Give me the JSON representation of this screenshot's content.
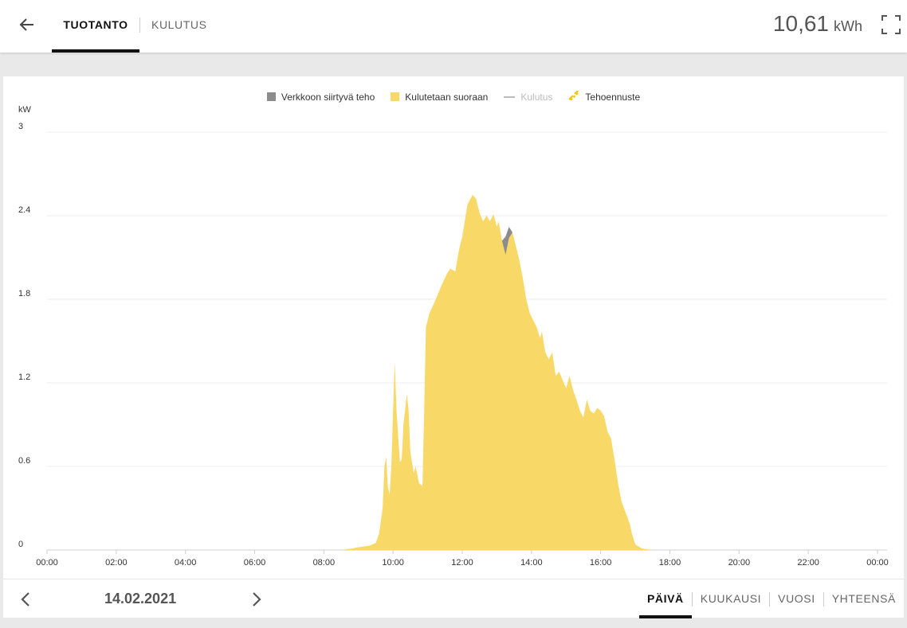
{
  "header": {
    "tabs": [
      {
        "label": "TUOTANTO",
        "active": true
      },
      {
        "label": "KULUTUS",
        "active": false
      }
    ],
    "total_value": "10,61",
    "total_unit": "kWh"
  },
  "legend": [
    {
      "label": "Verkkoon siirtyvä teho",
      "color": "#8c8c8c",
      "kind": "square"
    },
    {
      "label": "Kulutetaan suoraan",
      "color": "#f8d866",
      "kind": "square"
    },
    {
      "label": "Kulutus",
      "color": "#bbbbbb",
      "kind": "line"
    },
    {
      "label": "Tehoennuste",
      "color": "#f2c200",
      "kind": "dashed"
    }
  ],
  "chart_data": {
    "type": "area",
    "ylabel": "kW",
    "y_ticks": [
      "0",
      "0.6",
      "1.2",
      "1.8",
      "2.4",
      "3"
    ],
    "ylim": [
      0,
      3
    ],
    "xlim": [
      0,
      24
    ],
    "x_ticks": [
      "00:00",
      "02:00",
      "04:00",
      "06:00",
      "08:00",
      "10:00",
      "12:00",
      "14:00",
      "16:00",
      "18:00",
      "20:00",
      "22:00",
      "00:00"
    ],
    "grid": true,
    "legend_position": "top-center",
    "series": [
      {
        "name": "Kulutetaan suoraan",
        "color": "#f8d866",
        "points": [
          [
            0,
            0
          ],
          [
            8.5,
            0
          ],
          [
            8.8,
            0.01
          ],
          [
            9.0,
            0.02
          ],
          [
            9.3,
            0.03
          ],
          [
            9.5,
            0.05
          ],
          [
            9.6,
            0.12
          ],
          [
            9.7,
            0.3
          ],
          [
            9.75,
            0.6
          ],
          [
            9.8,
            0.67
          ],
          [
            9.85,
            0.45
          ],
          [
            9.9,
            0.4
          ],
          [
            9.95,
            0.6
          ],
          [
            10.0,
            1.0
          ],
          [
            10.05,
            1.35
          ],
          [
            10.1,
            1.0
          ],
          [
            10.2,
            0.63
          ],
          [
            10.25,
            0.65
          ],
          [
            10.3,
            0.9
          ],
          [
            10.4,
            1.12
          ],
          [
            10.45,
            1.0
          ],
          [
            10.5,
            0.7
          ],
          [
            10.6,
            0.55
          ],
          [
            10.65,
            0.6
          ],
          [
            10.75,
            0.48
          ],
          [
            10.85,
            0.46
          ],
          [
            10.9,
            1.0
          ],
          [
            10.95,
            1.6
          ],
          [
            11.05,
            1.7
          ],
          [
            11.2,
            1.78
          ],
          [
            11.4,
            1.9
          ],
          [
            11.55,
            1.98
          ],
          [
            11.65,
            2.02
          ],
          [
            11.8,
            2.0
          ],
          [
            11.9,
            2.15
          ],
          [
            12.0,
            2.25
          ],
          [
            12.15,
            2.48
          ],
          [
            12.3,
            2.55
          ],
          [
            12.4,
            2.52
          ],
          [
            12.5,
            2.42
          ],
          [
            12.6,
            2.36
          ],
          [
            12.7,
            2.4
          ],
          [
            12.8,
            2.36
          ],
          [
            12.9,
            2.41
          ],
          [
            13.0,
            2.32
          ],
          [
            13.05,
            2.36
          ],
          [
            13.15,
            2.22
          ],
          [
            13.25,
            2.15
          ],
          [
            13.35,
            2.3
          ],
          [
            13.45,
            2.28
          ],
          [
            13.55,
            2.18
          ],
          [
            13.65,
            2.08
          ],
          [
            13.75,
            1.95
          ],
          [
            13.85,
            1.8
          ],
          [
            13.95,
            1.7
          ],
          [
            14.05,
            1.65
          ],
          [
            14.15,
            1.6
          ],
          [
            14.25,
            1.52
          ],
          [
            14.3,
            1.57
          ],
          [
            14.4,
            1.42
          ],
          [
            14.5,
            1.37
          ],
          [
            14.6,
            1.42
          ],
          [
            14.7,
            1.25
          ],
          [
            14.8,
            1.28
          ],
          [
            14.9,
            1.22
          ],
          [
            15.0,
            1.16
          ],
          [
            15.1,
            1.25
          ],
          [
            15.2,
            1.15
          ],
          [
            15.3,
            1.08
          ],
          [
            15.4,
            1.0
          ],
          [
            15.5,
            0.95
          ],
          [
            15.6,
            1.08
          ],
          [
            15.7,
            1.0
          ],
          [
            15.8,
            0.98
          ],
          [
            15.9,
            1.02
          ],
          [
            16.0,
            1.0
          ],
          [
            16.1,
            0.96
          ],
          [
            16.2,
            0.85
          ],
          [
            16.3,
            0.8
          ],
          [
            16.4,
            0.65
          ],
          [
            16.5,
            0.48
          ],
          [
            16.6,
            0.35
          ],
          [
            16.75,
            0.25
          ],
          [
            16.85,
            0.18
          ],
          [
            16.9,
            0.12
          ],
          [
            17.0,
            0.04
          ],
          [
            17.2,
            0.01
          ],
          [
            17.5,
            0
          ],
          [
            24,
            0
          ]
        ]
      },
      {
        "name": "Verkkoon siirtyvä teho",
        "color": "#8c8c8c",
        "points": [
          [
            13.15,
            2.22
          ],
          [
            13.25,
            2.25
          ],
          [
            13.35,
            2.32
          ],
          [
            13.45,
            2.28
          ],
          [
            13.35,
            2.24
          ],
          [
            13.25,
            2.12
          ],
          [
            13.15,
            2.22
          ]
        ]
      }
    ]
  },
  "footer": {
    "date": "14.02.2021",
    "periods": [
      {
        "label": "PÄIVÄ",
        "active": true
      },
      {
        "label": "KUUKAUSI",
        "active": false
      },
      {
        "label": "VUOSI",
        "active": false
      },
      {
        "label": "YHTEENSÄ",
        "active": false
      }
    ]
  }
}
